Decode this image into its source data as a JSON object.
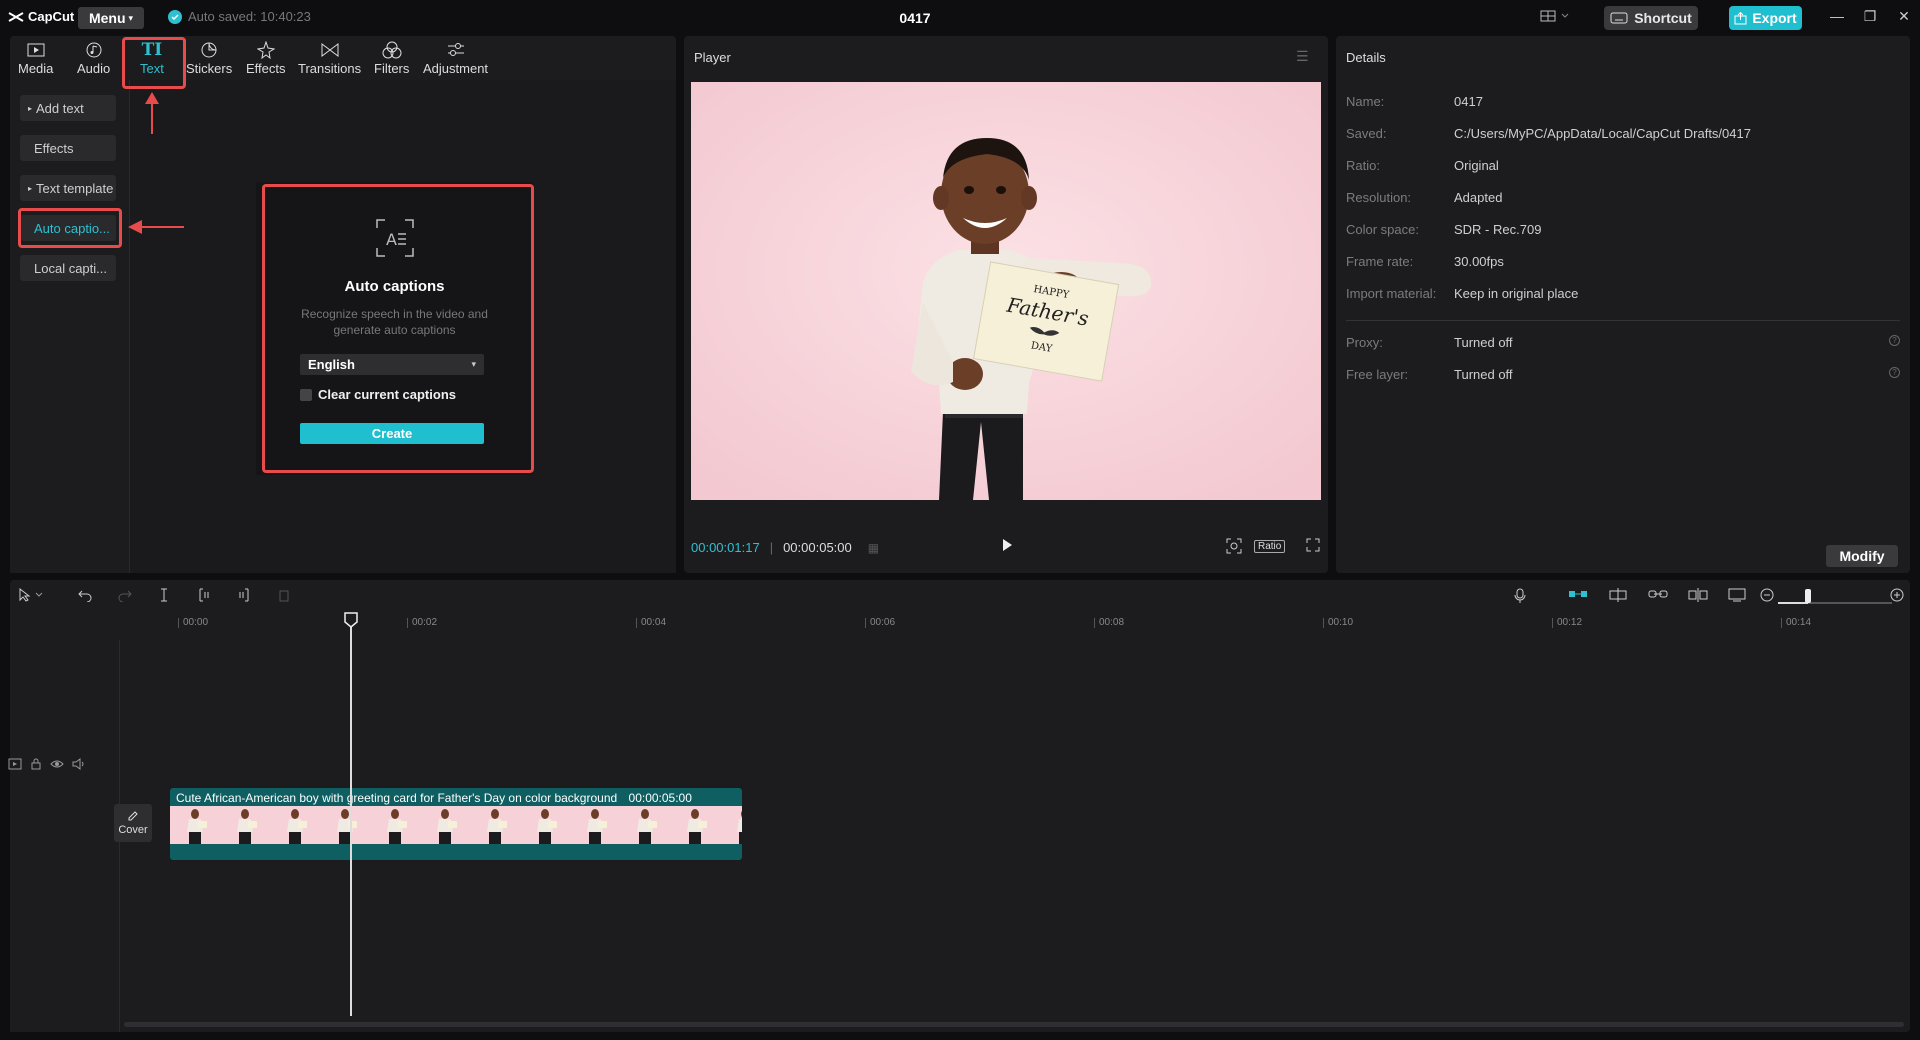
{
  "app": {
    "logo_text": "CapCut",
    "menu_label": "Menu",
    "autosave_text": "Auto saved: 10:40:23",
    "project_title": "0417",
    "shortcut_label": "Shortcut",
    "export_label": "Export"
  },
  "tabs": [
    {
      "label": "Media",
      "icon": "media-icon"
    },
    {
      "label": "Audio",
      "icon": "audio-icon"
    },
    {
      "label": "Text",
      "icon": "text-icon",
      "active": true
    },
    {
      "label": "Stickers",
      "icon": "stickers-icon"
    },
    {
      "label": "Effects",
      "icon": "effects-icon"
    },
    {
      "label": "Transitions",
      "icon": "transitions-icon"
    },
    {
      "label": "Filters",
      "icon": "filters-icon"
    },
    {
      "label": "Adjustment",
      "icon": "adjustment-icon"
    }
  ],
  "sidebar": {
    "items": [
      {
        "label": "Add text"
      },
      {
        "label": "Effects"
      },
      {
        "label": "Text template"
      },
      {
        "label": "Auto captio...",
        "active": true
      },
      {
        "label": "Local capti..."
      }
    ]
  },
  "auto_captions": {
    "title": "Auto captions",
    "description": "Recognize speech in the video and generate auto captions",
    "language": "English",
    "clear_label": "Clear current captions",
    "create_label": "Create"
  },
  "player": {
    "title": "Player",
    "current_time": "00:00:01:17",
    "total_time": "00:00:05:00",
    "ratio_label": "Ratio"
  },
  "details": {
    "title": "Details",
    "rows": [
      {
        "label": "Name:",
        "value": "0417"
      },
      {
        "label": "Saved:",
        "value": "C:/Users/MyPC/AppData/Local/CapCut Drafts/0417"
      },
      {
        "label": "Ratio:",
        "value": "Original"
      },
      {
        "label": "Resolution:",
        "value": "Adapted"
      },
      {
        "label": "Color space:",
        "value": "SDR - Rec.709"
      },
      {
        "label": "Frame rate:",
        "value": "30.00fps"
      },
      {
        "label": "Import material:",
        "value": "Keep in original place"
      }
    ],
    "extra_rows": [
      {
        "label": "Proxy:",
        "value": "Turned off"
      },
      {
        "label": "Free layer:",
        "value": "Turned off"
      }
    ],
    "modify_label": "Modify"
  },
  "timeline": {
    "ticks": [
      "00:00",
      "00:02",
      "00:04",
      "00:06",
      "00:08",
      "00:10",
      "00:12",
      "00:14"
    ],
    "cover_label": "Cover",
    "clip_title": "Cute African-American boy with greeting card for Father's Day on color background",
    "clip_duration": "00:00:05:00"
  },
  "card_text": {
    "line1": "HAPPY",
    "line2": "Father's",
    "line3": "DAY"
  },
  "colors": {
    "accent": "#1fbfd0",
    "highlight": "#e84b4b",
    "background": "#0e0e10",
    "panel": "#1c1c1f"
  }
}
